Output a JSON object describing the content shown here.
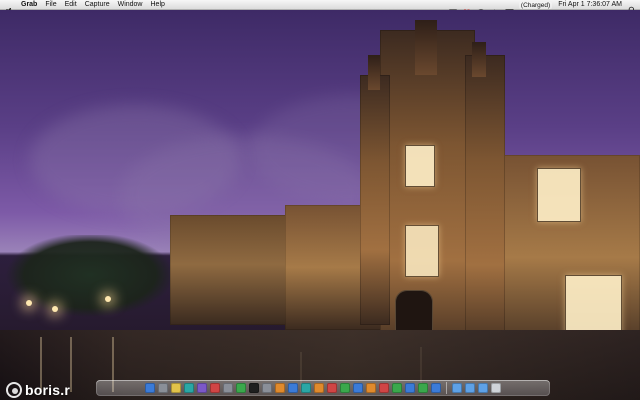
{
  "menubar": {
    "app_name": "Grab",
    "menus": [
      "File",
      "Edit",
      "Capture",
      "Window",
      "Help"
    ],
    "battery_text": "(Charged)",
    "datetime_text": "Fri Apr 1  7:36:07 AM"
  },
  "desktop": {
    "wallpaper": "gothic-building-night-photo"
  },
  "watermark": {
    "text": "boris.r"
  },
  "dock": {
    "icons": [
      "finder-icon",
      "dashboard-icon",
      "mail-icon",
      "safari-icon",
      "itunes-icon",
      "ical-icon",
      "address-book-icon",
      "preview-icon",
      "terminal-icon",
      "system-preferences-icon",
      "calculator-icon",
      "textedit-icon",
      "photoshop-icon",
      "illustrator-icon",
      "firefox-icon",
      "chrome-icon",
      "skype-icon",
      "vlc-icon",
      "transmission-icon",
      "adium-icon",
      "messages-icon",
      "evernote-icon",
      "dropbox-icon",
      "folder-icon",
      "downloads-icon",
      "documents-icon",
      "trash-icon"
    ],
    "colors": {
      "blue": "#3b7bd8",
      "green": "#3aa84c",
      "red": "#d04545",
      "orange": "#e08a2c",
      "purple": "#7b58c8",
      "gray": "#8a8f98",
      "yellow": "#e1c24a",
      "teal": "#2aa7a5"
    }
  }
}
